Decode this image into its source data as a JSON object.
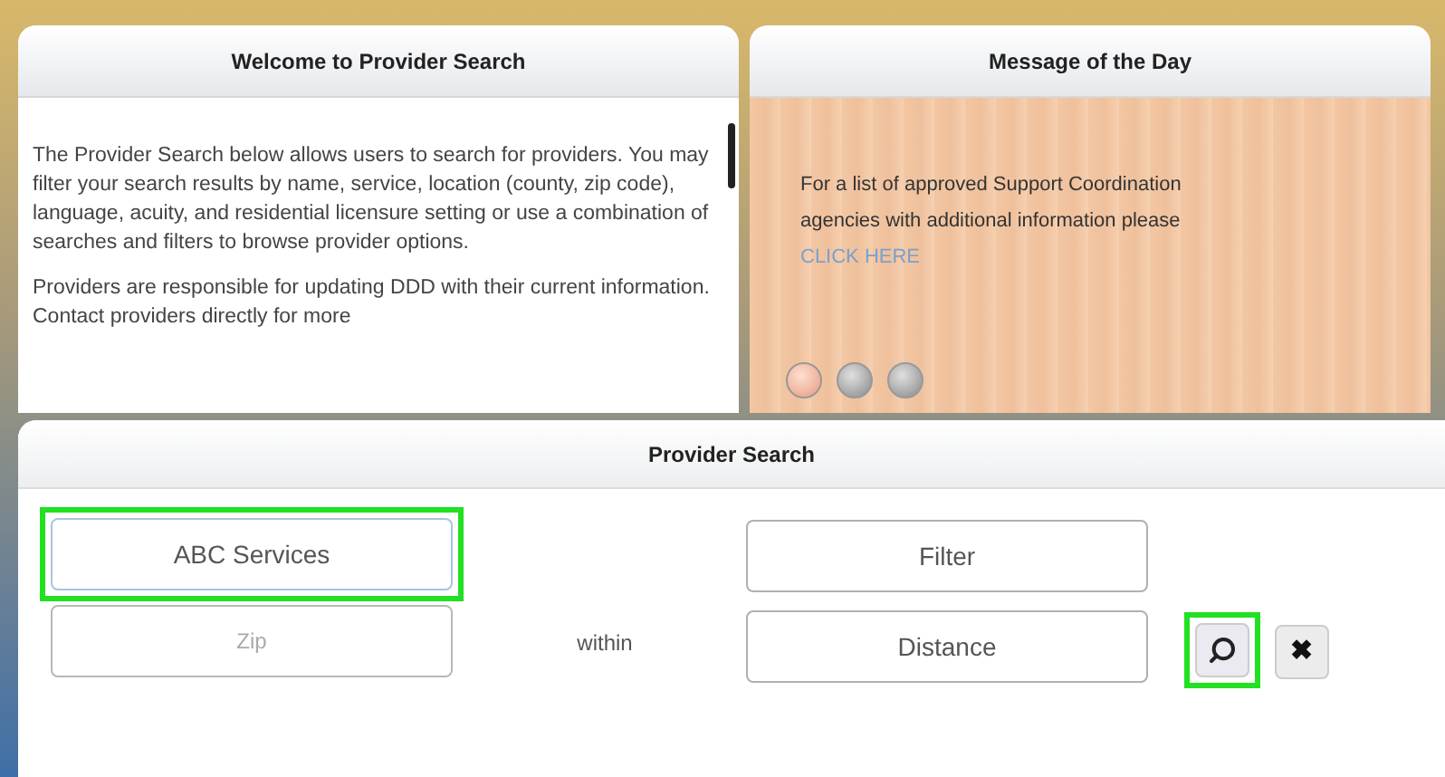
{
  "welcome": {
    "title": "Welcome to Provider Search",
    "paragraphs": [
      "The Provider Search below allows users to search for providers. You may filter your search results by name, service, location (county, zip code), language, acuity, and residential licensure setting or use a combination of searches and filters to browse provider options.",
      "Providers are responsible for updating DDD with their current information. Contact providers directly for more"
    ]
  },
  "message": {
    "title": "Message of the Day",
    "text": "For a list of approved Support Coordination agencies with additional information please",
    "link": "CLICK HERE",
    "dots": [
      {
        "selected": true
      },
      {
        "selected": false
      },
      {
        "selected": false
      }
    ]
  },
  "search": {
    "title": "Provider Search",
    "name_field": {
      "value": "ABC Services",
      "highlighted": true
    },
    "zip_field": {
      "placeholder": "Zip"
    },
    "within": "within",
    "filter": {
      "label": "Filter"
    },
    "distance": {
      "label": "Distance"
    },
    "search_button": {
      "highlighted": true
    },
    "clear_button": {
      "label": "✖"
    }
  }
}
